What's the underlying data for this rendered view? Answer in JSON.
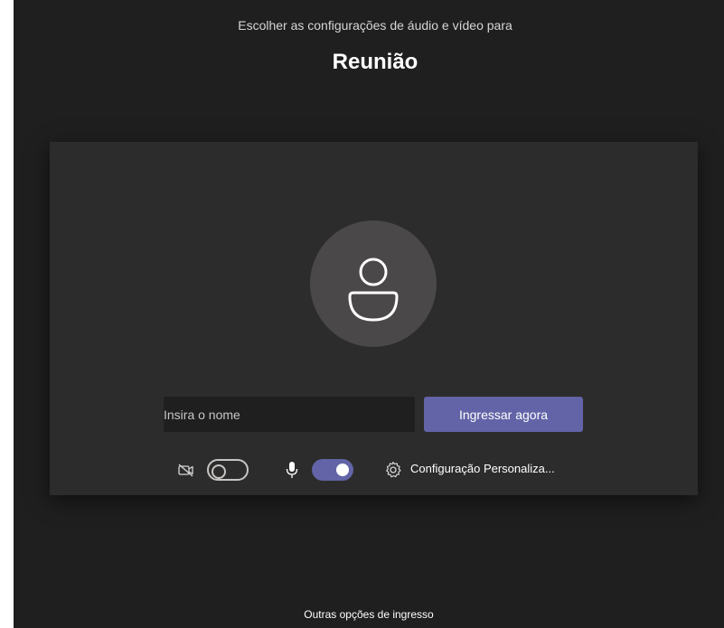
{
  "header": {
    "subtitle": "Escolher as configurações de áudio e vídeo para",
    "title": "Reunião"
  },
  "join": {
    "name_placeholder": "Insira o nome",
    "name_value": "",
    "join_button_label": "Ingressar agora"
  },
  "controls": {
    "camera_icon": "camera-off-icon",
    "camera_enabled": false,
    "mic_icon": "microphone-icon",
    "mic_enabled": true,
    "settings_icon": "gear-icon",
    "settings_label": "Configuração Personaliza..."
  },
  "footer": {
    "other_options_label": "Outras opções de ingresso"
  },
  "colors": {
    "background": "#1f1f1f",
    "panel": "#2d2c2c",
    "accent": "#6264a7",
    "avatar": "#4a4848"
  }
}
